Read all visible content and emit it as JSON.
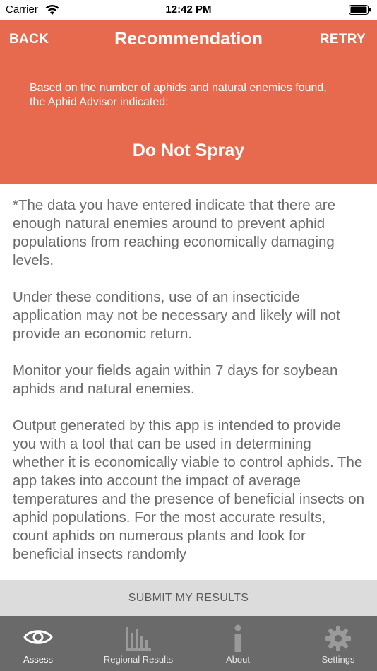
{
  "status_bar": {
    "carrier": "Carrier",
    "time": "12:42 PM"
  },
  "nav": {
    "back_label": "BACK",
    "title": "Recommendation",
    "retry_label": "RETRY"
  },
  "header": {
    "intro": "Based on the number of aphids and natural enemies found, the Aphid Advisor indicated:",
    "result": "Do Not Spray"
  },
  "content": {
    "paragraphs": [
      "*The data you have entered indicate that there are enough natural enemies around to prevent aphid populations from reaching economically damaging levels.",
      "Under these conditions, use of an insecticide application may not be necessary and likely will not provide an economic return.",
      "Monitor your fields again within 7 days for soybean aphids and natural enemies.",
      "Output generated by this app is intended to provide you with a tool that can be used in determining whether it is economically viable to control aphids. The app takes into account the impact of average temperatures and the presence of beneficial insects on aphid populations. For the most accurate results, count aphids on numerous plants and look for beneficial insects randomly"
    ]
  },
  "submit": {
    "label": "SUBMIT MY RESULTS"
  },
  "tabs": [
    {
      "label": "Assess",
      "icon": "eye-icon",
      "active": true
    },
    {
      "label": "Regional Results",
      "icon": "bar-chart-icon",
      "active": false
    },
    {
      "label": "About",
      "icon": "info-icon",
      "active": false
    },
    {
      "label": "Settings",
      "icon": "gear-icon",
      "active": false
    }
  ],
  "colors": {
    "header_bg": "#E86A4E",
    "body_text": "#6b6b6b",
    "submit_bg": "#dcdcdc",
    "tab_bar_bg": "#6a6a6a",
    "tab_icon_inactive": "#9a9a9a",
    "tab_icon_active": "#ffffff"
  }
}
